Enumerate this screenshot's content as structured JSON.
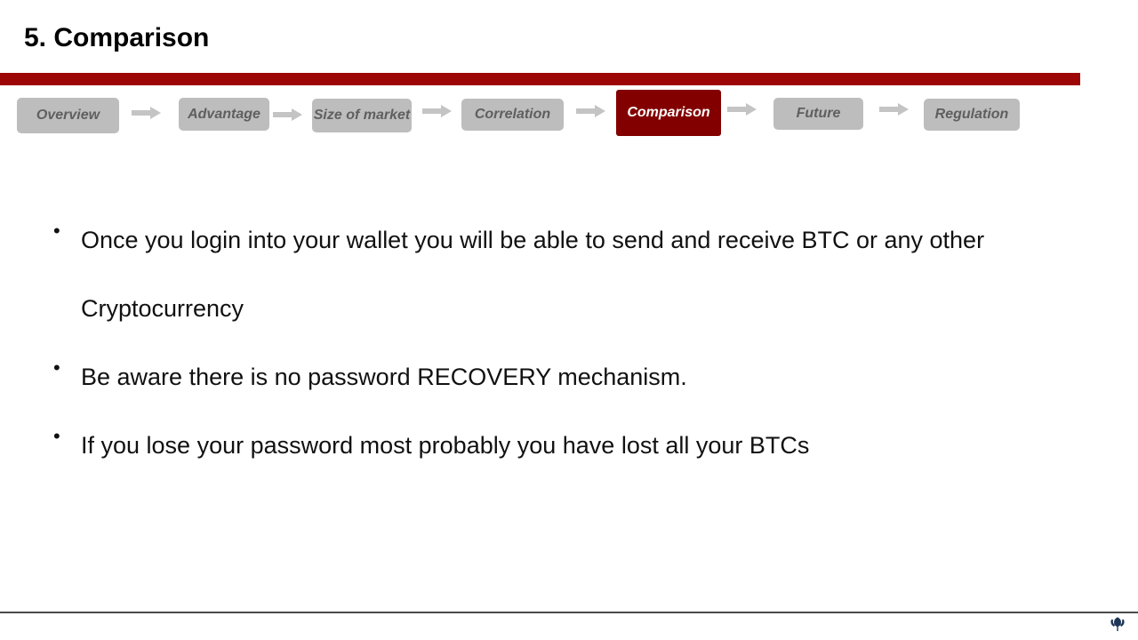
{
  "slide": {
    "title": "5. Comparison",
    "accent_color": "#9c0606",
    "active_color": "#820000",
    "inactive_color": "#bdbdbd"
  },
  "nav": {
    "steps": [
      {
        "label": "Overview",
        "active": false
      },
      {
        "label": "Advantage",
        "active": false
      },
      {
        "label": "Size of market",
        "active": false
      },
      {
        "label": "Correlation",
        "active": false
      },
      {
        "label": "Comparison",
        "active": true
      },
      {
        "label": "Future",
        "active": false
      },
      {
        "label": "Regulation",
        "active": false
      }
    ],
    "arrow_icon": "right-arrow-icon"
  },
  "content": {
    "bullets": [
      {
        "line1": "Once you login into your wallet you will be able to send and receive BTC or any other",
        "line2": "Cryptocurrency"
      },
      {
        "line1": "Be aware there is no password RECOVERY mechanism."
      },
      {
        "line1": "If you lose your password most probably you have lost all your BTCs"
      }
    ]
  },
  "footer": {
    "logo_icon": "thistle-logo-icon"
  }
}
